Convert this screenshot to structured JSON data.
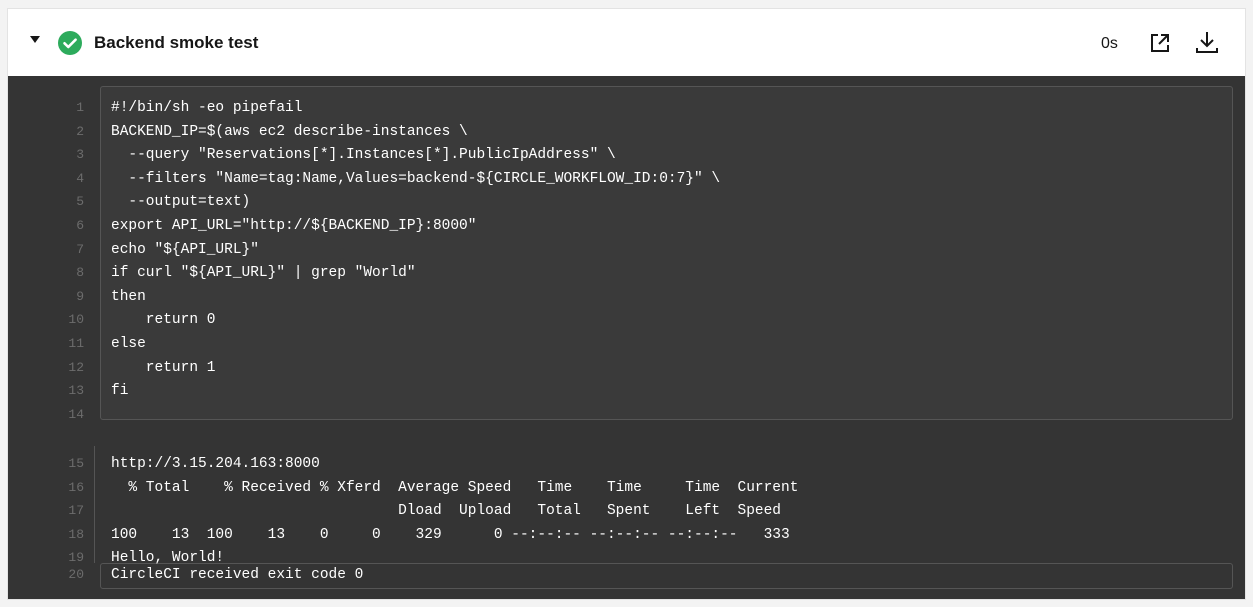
{
  "step": {
    "title": "Backend smoke test",
    "duration": "0s",
    "status": "success"
  },
  "colors": {
    "success": "#2dab5c",
    "terminal_bg": "#343434",
    "command_bg": "#3a3a3a"
  },
  "icons": [
    "chevron-down-icon",
    "success-check-icon",
    "external-link-icon",
    "download-icon"
  ],
  "command_lines": [
    {
      "n": "1",
      "t": "#!/bin/sh -eo pipefail"
    },
    {
      "n": "2",
      "t": "BACKEND_IP=$(aws ec2 describe-instances \\"
    },
    {
      "n": "3",
      "t": "  --query \"Reservations[*].Instances[*].PublicIpAddress\" \\"
    },
    {
      "n": "4",
      "t": "  --filters \"Name=tag:Name,Values=backend-${CIRCLE_WORKFLOW_ID:0:7}\" \\"
    },
    {
      "n": "5",
      "t": "  --output=text)"
    },
    {
      "n": "6",
      "t": "export API_URL=\"http://${BACKEND_IP}:8000\""
    },
    {
      "n": "7",
      "t": "echo \"${API_URL}\""
    },
    {
      "n": "8",
      "t": "if curl \"${API_URL}\" | grep \"World\""
    },
    {
      "n": "9",
      "t": "then"
    },
    {
      "n": "10",
      "t": "    return 0"
    },
    {
      "n": "11",
      "t": "else"
    },
    {
      "n": "12",
      "t": "    return 1"
    },
    {
      "n": "13",
      "t": "fi"
    },
    {
      "n": "14",
      "t": ""
    }
  ],
  "output_lines": [
    {
      "n": "15",
      "t": "http://3.15.204.163:8000"
    },
    {
      "n": "16",
      "t": "  % Total    % Received % Xferd  Average Speed   Time    Time     Time  Current"
    },
    {
      "n": "17",
      "t": "                                 Dload  Upload   Total   Spent    Left  Speed"
    },
    {
      "n": "18",
      "t": "100    13  100    13    0     0    329      0 --:--:-- --:--:-- --:--:--   333"
    },
    {
      "n": "19",
      "t": "Hello, World!"
    }
  ],
  "exit_line": {
    "n": "20",
    "t": "CircleCI received exit code 0"
  }
}
